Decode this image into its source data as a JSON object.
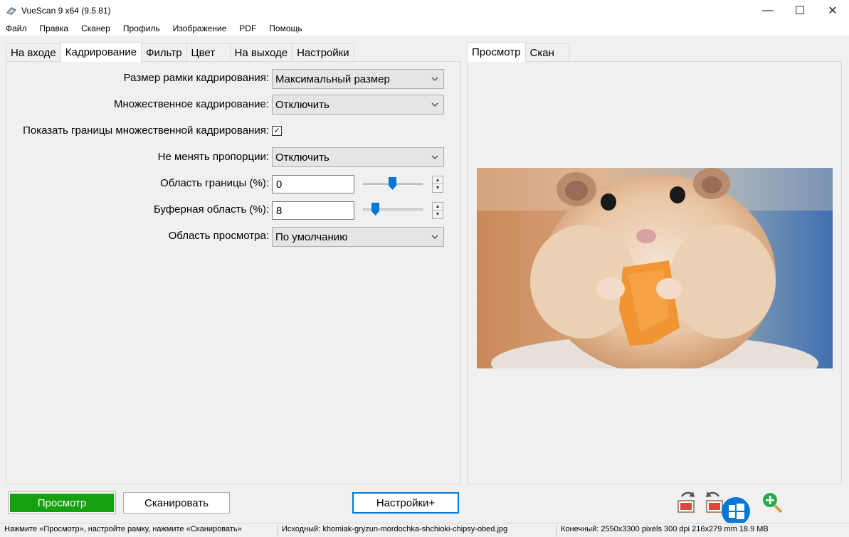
{
  "window": {
    "title": "VueScan 9 x64 (9.5.81)",
    "min_glyph": "—",
    "max_glyph": "☐",
    "close_glyph": "✕"
  },
  "menu": [
    "Файл",
    "Правка",
    "Сканер",
    "Профиль",
    "Изображение",
    "PDF",
    "Помощь"
  ],
  "left_tabs": [
    {
      "label": "На входе",
      "active": false
    },
    {
      "label": "Кадрирование",
      "active": true
    },
    {
      "label": "Фильтр",
      "active": false
    },
    {
      "label": "Цвет",
      "active": false
    },
    {
      "label": "На выходе",
      "active": false
    },
    {
      "label": "Настройки",
      "active": false
    }
  ],
  "right_tabs": [
    {
      "label": "Просмотр",
      "active": true
    },
    {
      "label": "Скан",
      "active": false
    }
  ],
  "crop": {
    "crop_size_label": "Размер рамки кадрирования:",
    "crop_size_value": "Максимальный размер",
    "multi_crop_label": "Множественное кадрирование:",
    "multi_crop_value": "Отключить",
    "show_borders_label": "Показать границы множественной кадрирования:",
    "show_borders_checked": true,
    "check_glyph": "✓",
    "keep_ratio_label": "Не менять пропорции:",
    "keep_ratio_value": "Отключить",
    "border_label": "Область границы (%):",
    "border_value": "0",
    "buffer_label": "Буферная область (%):",
    "buffer_value": "8",
    "preview_area_label": "Область просмотра:",
    "preview_area_value": "По умолчанию"
  },
  "buttons": {
    "preview": "Просмотр",
    "scan": "Сканировать",
    "more": "Настройки+"
  },
  "status": {
    "hint": "Нажмите «Просмотр», настройте рамку, нажмите «Сканировать»",
    "source": "Исходный: khomiak-gryzun-mordochka-shchioki-chipsy-obed.jpg",
    "output": "Конечный: 2550x3300 pixels 300 dpi 216x279 mm 18.9 MB"
  },
  "colors": {
    "preview_button": "#13a10e",
    "slider_thumb": "#0078d7",
    "focus_border": "#0078d7"
  }
}
